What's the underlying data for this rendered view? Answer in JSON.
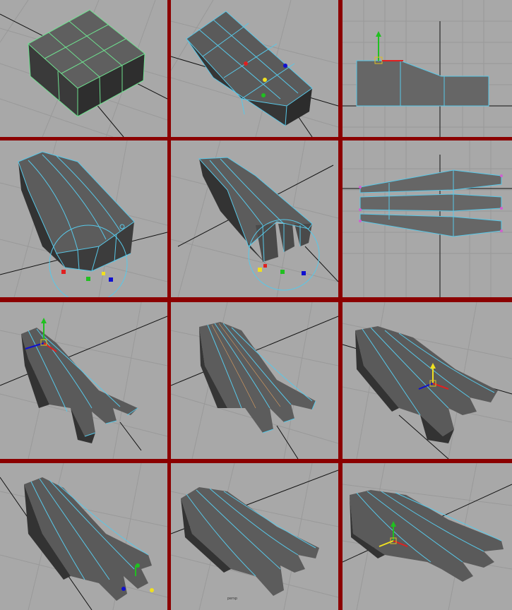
{
  "sheet": {
    "panel_count": 12,
    "colors": {
      "border": "#8b0000",
      "viewport_bg": "#a8a8a8",
      "grid_line": "#999999",
      "axis_line": "#111111",
      "mesh_face": "#5a5a5a",
      "mesh_face_dark": "#3c3c3c",
      "wire_green": "#6fe08f",
      "wire_cyan": "#58c8e8",
      "gizmo_x": "#e02020",
      "gizmo_y": "#20c020",
      "gizmo_z": "#1010d0",
      "gizmo_yellow": "#f0e020"
    },
    "steps": [
      {
        "id": 1,
        "view": "perspective",
        "description_icon": "cube-box-icon"
      },
      {
        "id": 2,
        "view": "perspective",
        "description_icon": "extruded-box-icon"
      },
      {
        "id": 3,
        "view": "side-orthographic",
        "description_icon": "side-profile-icon"
      },
      {
        "id": 4,
        "view": "perspective",
        "description_icon": "palm-block-icon"
      },
      {
        "id": 5,
        "view": "perspective",
        "description_icon": "finger-extrude-icon"
      },
      {
        "id": 6,
        "view": "top-orthographic",
        "description_icon": "top-fingers-icon"
      },
      {
        "id": 7,
        "view": "perspective",
        "description_icon": "hand-fingers-icon"
      },
      {
        "id": 8,
        "view": "perspective",
        "description_icon": "hand-smoothed-icon"
      },
      {
        "id": 9,
        "view": "perspective",
        "description_icon": "hand-tilted-icon"
      },
      {
        "id": 10,
        "view": "perspective",
        "description_icon": "hand-refined-icon"
      },
      {
        "id": 11,
        "view": "perspective",
        "description_icon": "hand-detailed-icon"
      },
      {
        "id": 12,
        "view": "perspective",
        "description_icon": "hand-final-icon"
      }
    ],
    "tiny_label": "persp"
  }
}
